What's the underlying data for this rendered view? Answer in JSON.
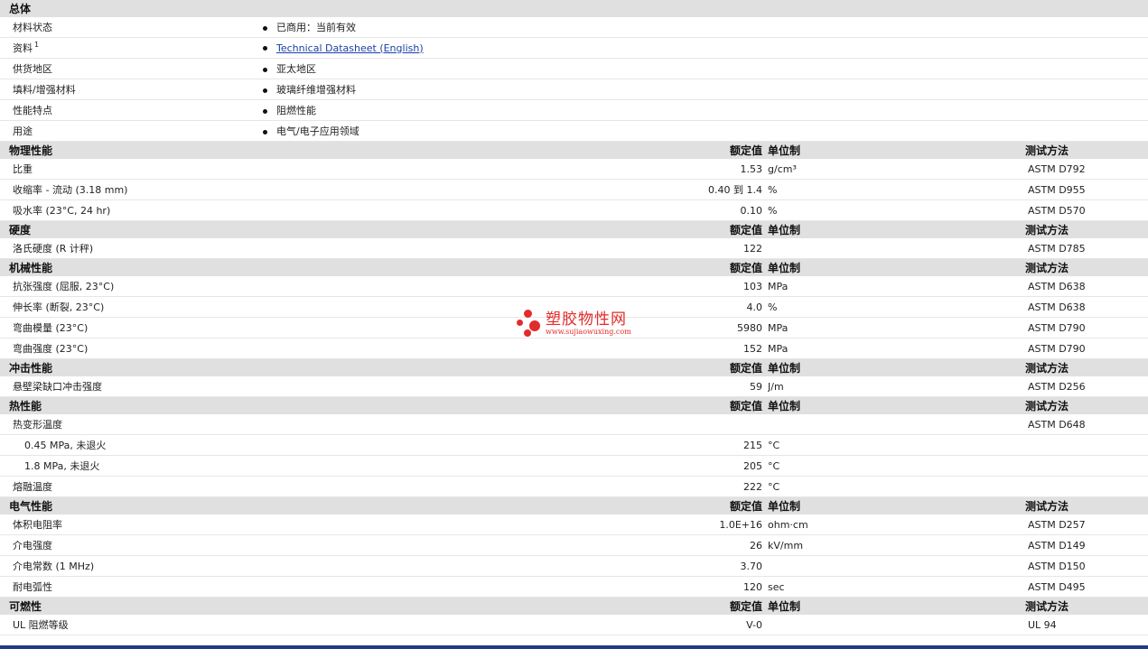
{
  "overview": {
    "title": "总体",
    "rows": [
      {
        "label": "材料状态",
        "value": "已商用：当前有效"
      },
      {
        "label": "资料",
        "sup": "1",
        "value": "Technical Datasheet (English)",
        "is_link": true
      },
      {
        "label": "供货地区",
        "value": "亚太地区"
      },
      {
        "label": "填料/增强材料",
        "value": "玻璃纤维增强材料"
      },
      {
        "label": "性能特点",
        "value": "阻燃性能"
      },
      {
        "label": "用途",
        "value": "电气/电子应用领域"
      }
    ]
  },
  "headers": {
    "nominal": "额定值",
    "unit": "单位制",
    "method": "测试方法"
  },
  "sections": [
    {
      "title": "物理性能",
      "rows": [
        {
          "label": "比重",
          "value": "1.53",
          "unit": "g/cm³",
          "method": "ASTM D792"
        },
        {
          "label": "收缩率 - 流动 (3.18 mm)",
          "value": "0.40 到  1.4",
          "unit": "%",
          "method": "ASTM D955"
        },
        {
          "label": "吸水率 (23°C, 24 hr)",
          "value": "0.10",
          "unit": "%",
          "method": "ASTM D570"
        }
      ]
    },
    {
      "title": "硬度",
      "rows": [
        {
          "label": "洛氏硬度 (R 计秤)",
          "value": "122",
          "unit": "",
          "method": "ASTM D785"
        }
      ]
    },
    {
      "title": "机械性能",
      "rows": [
        {
          "label": "抗张强度 (屈服, 23°C)",
          "value": "103",
          "unit": "MPa",
          "method": "ASTM D638"
        },
        {
          "label": "伸长率 (断裂, 23°C)",
          "value": "4.0",
          "unit": "%",
          "method": "ASTM D638"
        },
        {
          "label": "弯曲模量 (23°C)",
          "value": "5980",
          "unit": "MPa",
          "method": "ASTM D790"
        },
        {
          "label": "弯曲强度 (23°C)",
          "value": "152",
          "unit": "MPa",
          "method": "ASTM D790"
        }
      ]
    },
    {
      "title": "冲击性能",
      "rows": [
        {
          "label": "悬壁梁缺口冲击强度",
          "value": "59",
          "unit": "J/m",
          "method": "ASTM D256"
        }
      ]
    },
    {
      "title": "热性能",
      "rows": [
        {
          "label": "热变形温度",
          "value": "",
          "unit": "",
          "method": "ASTM D648"
        },
        {
          "label": "0.45 MPa, 未退火",
          "value": "215",
          "unit": "°C",
          "method": "",
          "sub": true
        },
        {
          "label": "1.8 MPa, 未退火",
          "value": "205",
          "unit": "°C",
          "method": "",
          "sub": true
        },
        {
          "label": "熔融温度",
          "value": "222",
          "unit": "°C",
          "method": ""
        }
      ]
    },
    {
      "title": "电气性能",
      "rows": [
        {
          "label": "体积电阻率",
          "value": "1.0E+16",
          "unit": "ohm·cm",
          "method": "ASTM D257"
        },
        {
          "label": "介电强度",
          "value": "26",
          "unit": "kV/mm",
          "method": "ASTM D149"
        },
        {
          "label": "介电常数 (1 MHz)",
          "value": "3.70",
          "unit": "",
          "method": "ASTM D150"
        },
        {
          "label": "耐电弧性",
          "value": "120",
          "unit": "sec",
          "method": "ASTM D495"
        }
      ]
    },
    {
      "title": "可燃性",
      "rows": [
        {
          "label": "UL 阻燃等级",
          "value": "V-0",
          "unit": "",
          "method": "UL 94"
        }
      ]
    }
  ],
  "watermark": {
    "name": "塑胶物性网",
    "url": "www.sujiaowuxing.com"
  },
  "colors": {
    "section_bg": "#e0e0e0",
    "link": "#1a3fa8",
    "watermark": "#e22b2b",
    "bottom_bar": "#1f3c85"
  }
}
